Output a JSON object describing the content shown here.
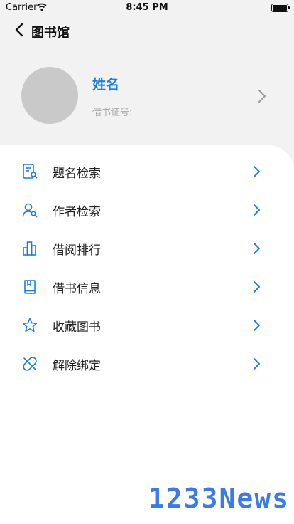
{
  "status_bar": {
    "carrier": "Carrier",
    "time": "8:45 PM"
  },
  "nav": {
    "title": "图书馆"
  },
  "profile": {
    "name": "姓名",
    "card_label": "借书证号:"
  },
  "menu": [
    {
      "label": "题名检索",
      "icon": "title-search-icon"
    },
    {
      "label": "作者检索",
      "icon": "author-search-icon"
    },
    {
      "label": "借阅排行",
      "icon": "ranking-chart-icon"
    },
    {
      "label": "借书信息",
      "icon": "book-info-icon"
    },
    {
      "label": "收藏图书",
      "icon": "star-icon"
    },
    {
      "label": "解除绑定",
      "icon": "unbind-icon"
    }
  ],
  "watermark": "1233News",
  "colors": {
    "accent": "#1a7ee0",
    "background": "#f2f2f2",
    "panel": "#ffffff"
  }
}
